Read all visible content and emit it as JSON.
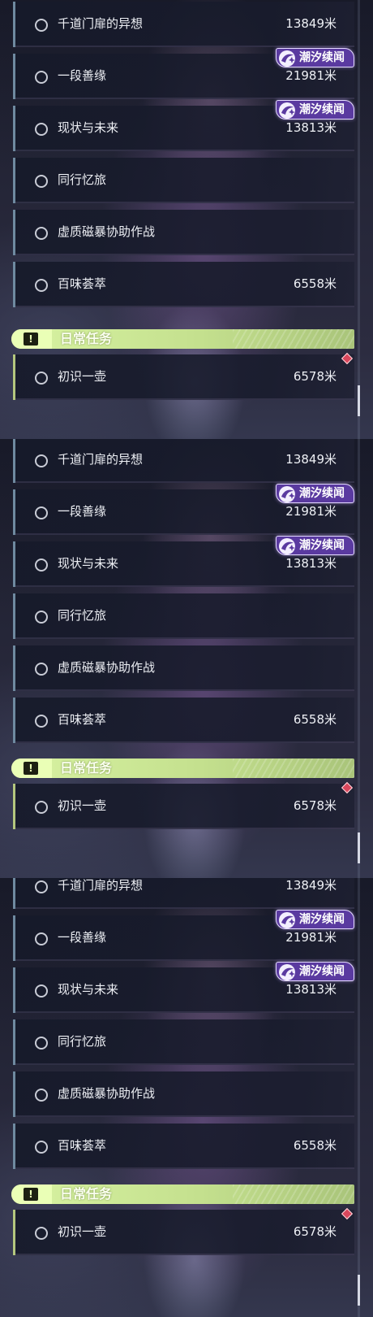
{
  "panels": [
    {
      "quests": [
        {
          "name": "千道门扉的异想",
          "distance": "13849米"
        },
        {
          "name": "一段善缘",
          "distance": "21981米",
          "tag": "潮汐续闻"
        },
        {
          "name": "现状与未来",
          "distance": "13813米",
          "tag": "潮汐续闻"
        },
        {
          "name": "同行忆旅",
          "distance": ""
        },
        {
          "name": "虚质磁暴协助作战",
          "distance": ""
        },
        {
          "name": "百味荟萃",
          "distance": "6558米"
        }
      ],
      "section": {
        "title": "日常任务",
        "icon": "exclamation-icon"
      },
      "daily": [
        {
          "name": "初识一壶",
          "distance": "6578米"
        }
      ]
    },
    {
      "quests": [
        {
          "name": "千道门扉的异想",
          "distance": "13849米"
        },
        {
          "name": "一段善缘",
          "distance": "21981米",
          "tag": "潮汐续闻"
        },
        {
          "name": "现状与未来",
          "distance": "13813米",
          "tag": "潮汐续闻"
        },
        {
          "name": "同行忆旅",
          "distance": ""
        },
        {
          "name": "虚质磁暴协助作战",
          "distance": ""
        },
        {
          "name": "百味荟萃",
          "distance": "6558米"
        }
      ],
      "section": {
        "title": "日常任务",
        "icon": "exclamation-icon"
      },
      "daily": [
        {
          "name": "初识一壶",
          "distance": "6578米"
        }
      ]
    },
    {
      "quests": [
        {
          "name": "千道门扉的异想",
          "distance": "13849米"
        },
        {
          "name": "一段善缘",
          "distance": "21981米",
          "tag": "潮汐续闻"
        },
        {
          "name": "现状与未来",
          "distance": "13813米",
          "tag": "潮汐续闻"
        },
        {
          "name": "同行忆旅",
          "distance": ""
        },
        {
          "name": "虚质磁暴协助作战",
          "distance": ""
        },
        {
          "name": "百味荟萃",
          "distance": "6558米"
        }
      ],
      "section": {
        "title": "日常任务",
        "icon": "exclamation-icon"
      },
      "daily": [
        {
          "name": "初识一壶",
          "distance": "6578米"
        }
      ]
    }
  ],
  "colors": {
    "quest_accent": "#6f8aa0",
    "daily_accent": "#b4c77e",
    "tag_bg": "#5a3aa0",
    "daily_header": "#c4e08e",
    "tracked_marker": "#d9475c"
  }
}
